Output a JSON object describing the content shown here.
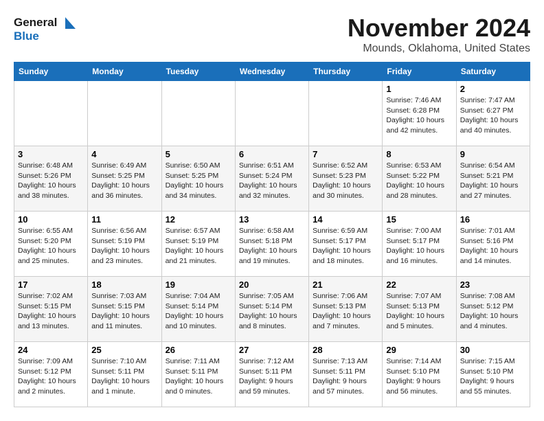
{
  "logo": {
    "line1": "General",
    "line2": "Blue"
  },
  "title": "November 2024",
  "location": "Mounds, Oklahoma, United States",
  "days_of_week": [
    "Sunday",
    "Monday",
    "Tuesday",
    "Wednesday",
    "Thursday",
    "Friday",
    "Saturday"
  ],
  "weeks": [
    [
      {
        "day": "",
        "info": ""
      },
      {
        "day": "",
        "info": ""
      },
      {
        "day": "",
        "info": ""
      },
      {
        "day": "",
        "info": ""
      },
      {
        "day": "",
        "info": ""
      },
      {
        "day": "1",
        "info": "Sunrise: 7:46 AM\nSunset: 6:28 PM\nDaylight: 10 hours\nand 42 minutes."
      },
      {
        "day": "2",
        "info": "Sunrise: 7:47 AM\nSunset: 6:27 PM\nDaylight: 10 hours\nand 40 minutes."
      }
    ],
    [
      {
        "day": "3",
        "info": "Sunrise: 6:48 AM\nSunset: 5:26 PM\nDaylight: 10 hours\nand 38 minutes."
      },
      {
        "day": "4",
        "info": "Sunrise: 6:49 AM\nSunset: 5:25 PM\nDaylight: 10 hours\nand 36 minutes."
      },
      {
        "day": "5",
        "info": "Sunrise: 6:50 AM\nSunset: 5:25 PM\nDaylight: 10 hours\nand 34 minutes."
      },
      {
        "day": "6",
        "info": "Sunrise: 6:51 AM\nSunset: 5:24 PM\nDaylight: 10 hours\nand 32 minutes."
      },
      {
        "day": "7",
        "info": "Sunrise: 6:52 AM\nSunset: 5:23 PM\nDaylight: 10 hours\nand 30 minutes."
      },
      {
        "day": "8",
        "info": "Sunrise: 6:53 AM\nSunset: 5:22 PM\nDaylight: 10 hours\nand 28 minutes."
      },
      {
        "day": "9",
        "info": "Sunrise: 6:54 AM\nSunset: 5:21 PM\nDaylight: 10 hours\nand 27 minutes."
      }
    ],
    [
      {
        "day": "10",
        "info": "Sunrise: 6:55 AM\nSunset: 5:20 PM\nDaylight: 10 hours\nand 25 minutes."
      },
      {
        "day": "11",
        "info": "Sunrise: 6:56 AM\nSunset: 5:19 PM\nDaylight: 10 hours\nand 23 minutes."
      },
      {
        "day": "12",
        "info": "Sunrise: 6:57 AM\nSunset: 5:19 PM\nDaylight: 10 hours\nand 21 minutes."
      },
      {
        "day": "13",
        "info": "Sunrise: 6:58 AM\nSunset: 5:18 PM\nDaylight: 10 hours\nand 19 minutes."
      },
      {
        "day": "14",
        "info": "Sunrise: 6:59 AM\nSunset: 5:17 PM\nDaylight: 10 hours\nand 18 minutes."
      },
      {
        "day": "15",
        "info": "Sunrise: 7:00 AM\nSunset: 5:17 PM\nDaylight: 10 hours\nand 16 minutes."
      },
      {
        "day": "16",
        "info": "Sunrise: 7:01 AM\nSunset: 5:16 PM\nDaylight: 10 hours\nand 14 minutes."
      }
    ],
    [
      {
        "day": "17",
        "info": "Sunrise: 7:02 AM\nSunset: 5:15 PM\nDaylight: 10 hours\nand 13 minutes."
      },
      {
        "day": "18",
        "info": "Sunrise: 7:03 AM\nSunset: 5:15 PM\nDaylight: 10 hours\nand 11 minutes."
      },
      {
        "day": "19",
        "info": "Sunrise: 7:04 AM\nSunset: 5:14 PM\nDaylight: 10 hours\nand 10 minutes."
      },
      {
        "day": "20",
        "info": "Sunrise: 7:05 AM\nSunset: 5:14 PM\nDaylight: 10 hours\nand 8 minutes."
      },
      {
        "day": "21",
        "info": "Sunrise: 7:06 AM\nSunset: 5:13 PM\nDaylight: 10 hours\nand 7 minutes."
      },
      {
        "day": "22",
        "info": "Sunrise: 7:07 AM\nSunset: 5:13 PM\nDaylight: 10 hours\nand 5 minutes."
      },
      {
        "day": "23",
        "info": "Sunrise: 7:08 AM\nSunset: 5:12 PM\nDaylight: 10 hours\nand 4 minutes."
      }
    ],
    [
      {
        "day": "24",
        "info": "Sunrise: 7:09 AM\nSunset: 5:12 PM\nDaylight: 10 hours\nand 2 minutes."
      },
      {
        "day": "25",
        "info": "Sunrise: 7:10 AM\nSunset: 5:11 PM\nDaylight: 10 hours\nand 1 minute."
      },
      {
        "day": "26",
        "info": "Sunrise: 7:11 AM\nSunset: 5:11 PM\nDaylight: 10 hours\nand 0 minutes."
      },
      {
        "day": "27",
        "info": "Sunrise: 7:12 AM\nSunset: 5:11 PM\nDaylight: 9 hours\nand 59 minutes."
      },
      {
        "day": "28",
        "info": "Sunrise: 7:13 AM\nSunset: 5:11 PM\nDaylight: 9 hours\nand 57 minutes."
      },
      {
        "day": "29",
        "info": "Sunrise: 7:14 AM\nSunset: 5:10 PM\nDaylight: 9 hours\nand 56 minutes."
      },
      {
        "day": "30",
        "info": "Sunrise: 7:15 AM\nSunset: 5:10 PM\nDaylight: 9 hours\nand 55 minutes."
      }
    ]
  ]
}
